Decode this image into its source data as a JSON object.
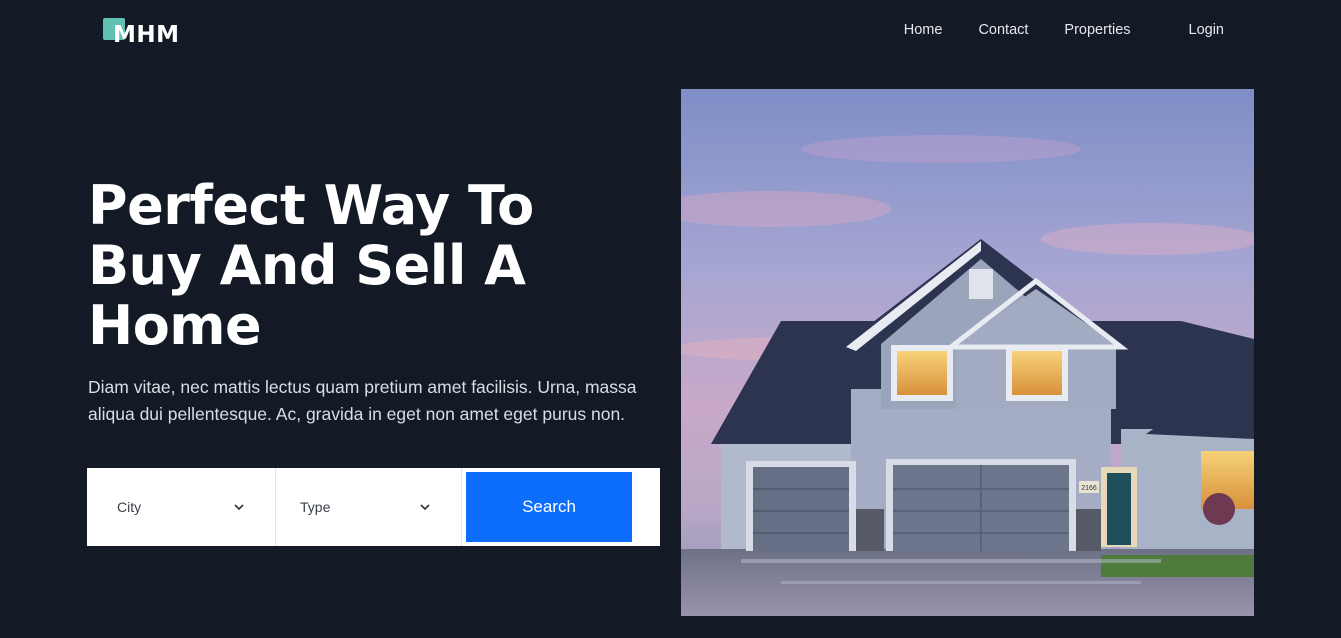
{
  "header": {
    "logo_text": "MHM",
    "nav": {
      "home": "Home",
      "contact": "Contact",
      "properties": "Properties",
      "login": "Login"
    }
  },
  "hero": {
    "title": "Perfect Way To Buy And Sell A Home",
    "subtitle": "Diam vitae, nec mattis lectus quam pretium amet facilisis. Urna, massa aliqua dui pellentesque. Ac, gravida in eget non amet eget purus non."
  },
  "search": {
    "city_label": "City",
    "type_label": "Type",
    "button_label": "Search",
    "number_plate": "2166"
  },
  "colors": {
    "background": "#131a26",
    "accent": "#0d6efd",
    "logo_mark": "#5fc1b2"
  },
  "icons": {
    "dropdown": "chevron-down-icon",
    "image": "house-photo"
  }
}
